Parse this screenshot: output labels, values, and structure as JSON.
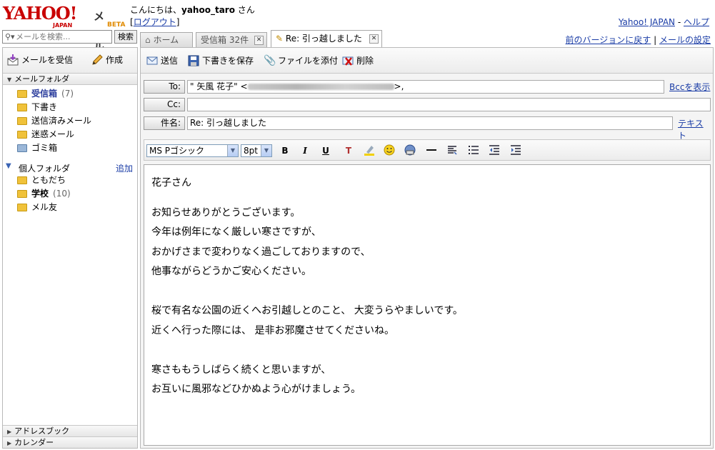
{
  "app": {
    "logo_text": "YAHOO!",
    "logo_sub": "JAPAN",
    "app_name": "メール",
    "beta": "BETA"
  },
  "header": {
    "greeting_prefix": "こんにちは、",
    "username": "yahoo_taro",
    "greeting_suffix": " さん",
    "logout": "ログアウト",
    "yahoo_japan_link": "Yahoo! JAPAN",
    "help_link": "ヘルプ"
  },
  "search": {
    "placeholder": "メールを検索...",
    "button": "検索"
  },
  "left_actions": {
    "receive": "メールを受信",
    "compose": "作成"
  },
  "mail_folders": {
    "heading": "メールフォルダ",
    "items": [
      {
        "label": "受信箱",
        "count": "(7)"
      },
      {
        "label": "下書き"
      },
      {
        "label": "送信済みメール"
      },
      {
        "label": "迷惑メール"
      },
      {
        "label": "ゴミ箱"
      }
    ]
  },
  "personal_folders": {
    "heading": "個人フォルダ",
    "add": "追加",
    "items": [
      {
        "label": "ともだち"
      },
      {
        "label": "学校",
        "count": "(10)"
      },
      {
        "label": "メル友"
      }
    ]
  },
  "bottom_sections": {
    "address_book": "アドレスブック",
    "calendar": "カレンダー"
  },
  "tabs": [
    {
      "label": "ホーム"
    },
    {
      "label": "受信箱 32件"
    },
    {
      "label": "Re: 引っ越しました"
    }
  ],
  "right_links": {
    "old_version": "前のバージョンに戻す",
    "settings": "メールの設定"
  },
  "compose_toolbar": {
    "send": "送信",
    "save_draft": "下書きを保存",
    "attach": "ファイルを添付",
    "delete": "削除"
  },
  "compose": {
    "to_label": "To:",
    "to_value_prefix": "\" 矢風 花子\" <",
    "to_value_suffix": ">,",
    "bcc_link": "Bccを表示",
    "cc_label": "Cc:",
    "cc_value": "",
    "subject_label": "件名:",
    "subject_value": "Re: 引っ越しました",
    "text_link": "テキスト"
  },
  "format_bar": {
    "font": "MS Pゴシック",
    "size": "8pt"
  },
  "body": {
    "greeting": "花子さん",
    "para1": [
      "お知らせありがとうございます。",
      "今年は例年になく厳しい寒さですが、",
      "おかげさまで変わりなく過ごしておりますので、",
      "他事ながらどうかご安心ください。"
    ],
    "para2": [
      "桜で有名な公園の近くへお引越しとのこと、 大変うらやましいです。",
      "近くへ行った際には、 是非お邪魔させてくださいね。"
    ],
    "para3": [
      "寒さももうしばらく続くと思いますが、",
      "お互いに風邪などひかぬよう心がけましょう。"
    ]
  }
}
